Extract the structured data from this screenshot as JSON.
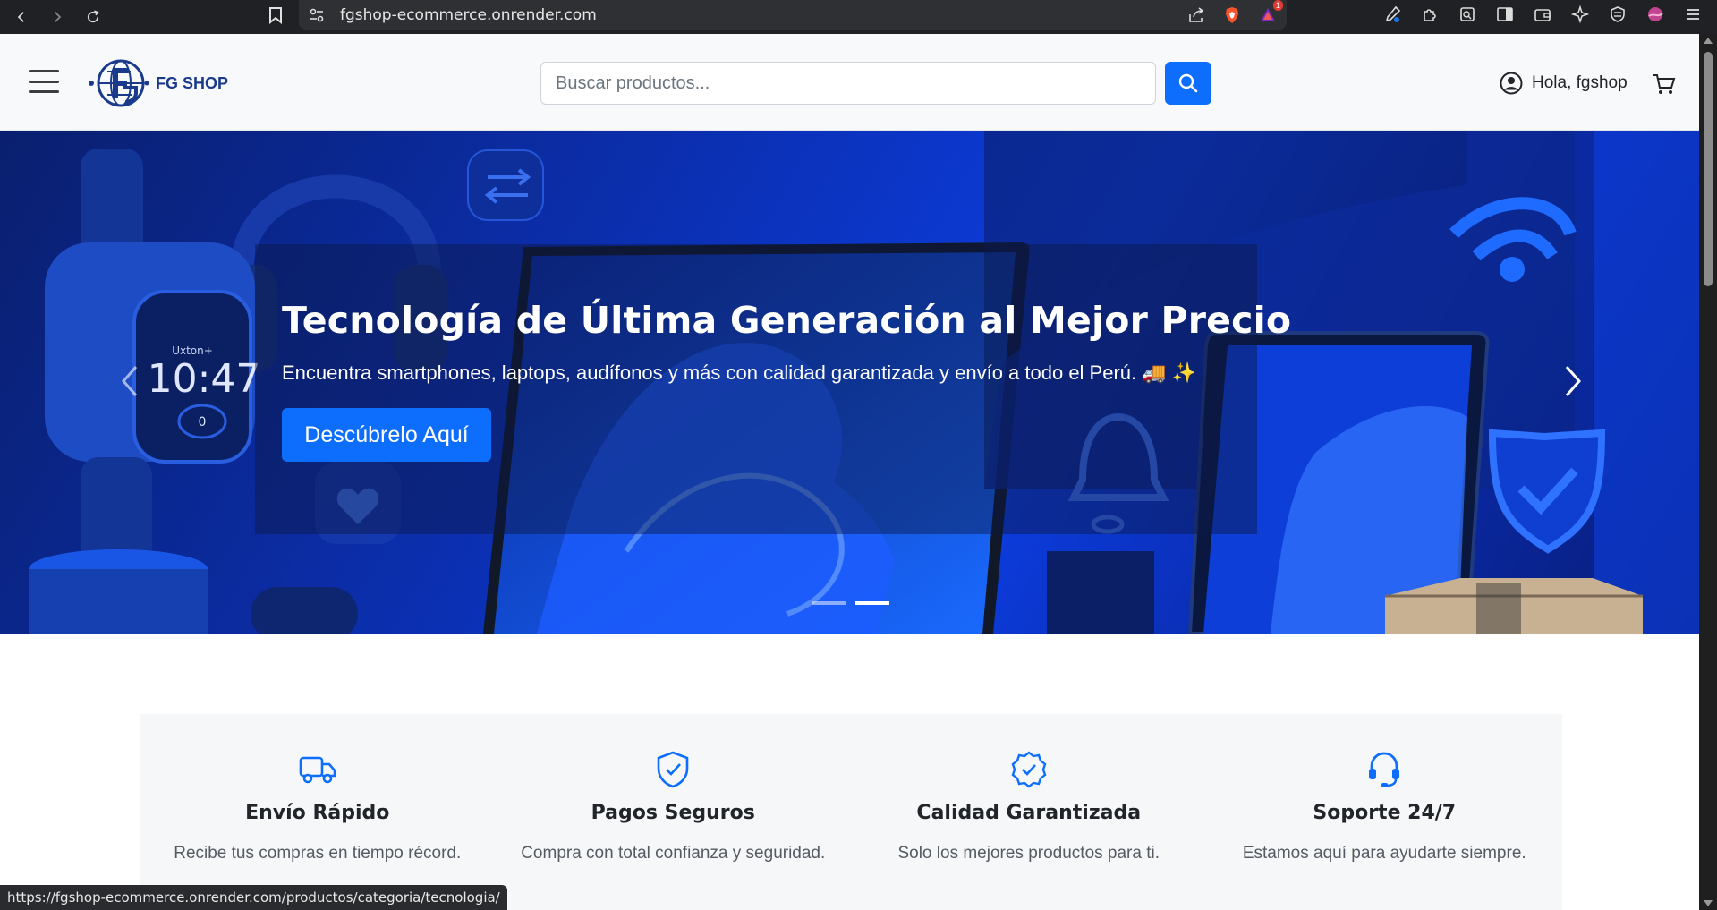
{
  "browser": {
    "url": "fgshop-ecommerce.onrender.com",
    "status_url": "https://fgshop-ecommerce.onrender.com/productos/categoria/tecnologia/",
    "notification_count": "1"
  },
  "header": {
    "logo_text": "FG SHOP",
    "search_placeholder": "Buscar productos...",
    "greeting": "Hola, fgshop"
  },
  "hero": {
    "title": "Tecnología de Última Generación al Mejor Precio",
    "subtitle": "Encuentra smartphones, laptops, audífonos y más con calidad garantizada y envío a todo el Perú. 🚚 ✨",
    "button_label": "Descúbrelo Aquí",
    "watch_time": "10:47",
    "watch_brand": "Uxton+",
    "watch_counter": "0",
    "slides": 2,
    "active_slide": 2
  },
  "features": [
    {
      "icon": "truck-icon",
      "title": "Envío Rápido",
      "text": "Recibe tus compras en tiempo récord."
    },
    {
      "icon": "shield-check-icon",
      "title": "Pagos Seguros",
      "text": "Compra con total confianza y seguridad."
    },
    {
      "icon": "badge-check-icon",
      "title": "Calidad Garantizada",
      "text": "Solo los mejores productos para ti."
    },
    {
      "icon": "headset-icon",
      "title": "Soporte 24/7",
      "text": "Estamos aquí para ayudarte siempre."
    }
  ],
  "colors": {
    "primary": "#0d6efd",
    "logo": "#1a3a8c",
    "hero_bg": "#0b2fb0"
  }
}
